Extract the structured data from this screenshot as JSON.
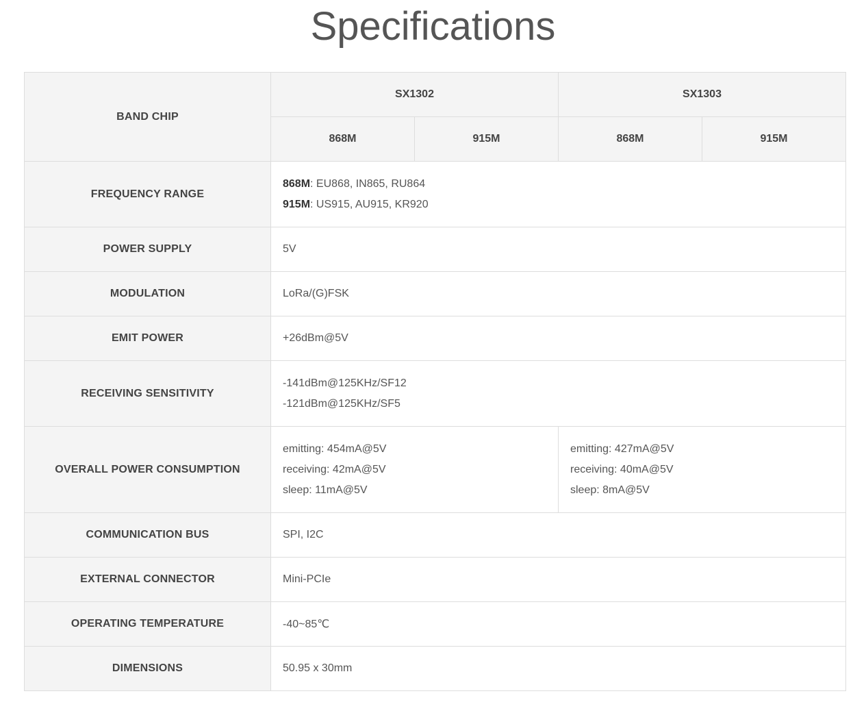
{
  "title": "Specifications",
  "table": {
    "band_chip_label": "BAND CHIP",
    "chips": [
      {
        "name": "SX1302",
        "bands": [
          "868M",
          "915M"
        ]
      },
      {
        "name": "SX1303",
        "bands": [
          "868M",
          "915M"
        ]
      }
    ],
    "frequency_range": {
      "label": "FREQUENCY RANGE",
      "lines": [
        {
          "key": "868M",
          "value": ": EU868, IN865, RU864"
        },
        {
          "key": "915M",
          "value": ": US915, AU915, KR920"
        }
      ]
    },
    "power_supply": {
      "label": "POWER SUPPLY",
      "value": "5V"
    },
    "modulation": {
      "label": "MODULATION",
      "value": "LoRa/(G)FSK"
    },
    "emit_power": {
      "label": "EMIT POWER",
      "value": "+26dBm@5V"
    },
    "receiving_sensitivity": {
      "label": "RECEIVING SENSITIVITY",
      "lines": [
        "-141dBm@125KHz/SF12",
        "-121dBm@125KHz/SF5"
      ]
    },
    "overall_power_consumption": {
      "label": "OVERALL POWER CONSUMPTION",
      "sx1302": [
        "emitting: 454mA@5V",
        "receiving: 42mA@5V",
        "sleep: 11mA@5V"
      ],
      "sx1303": [
        "emitting: 427mA@5V",
        "receiving: 40mA@5V",
        "sleep: 8mA@5V"
      ]
    },
    "communication_bus": {
      "label": "COMMUNICATION BUS",
      "value": "SPI, I2C"
    },
    "external_connector": {
      "label": "EXTERNAL CONNECTOR",
      "value": "Mini-PCIe"
    },
    "operating_temperature": {
      "label": "OPERATING TEMPERATURE",
      "value": "-40~85℃"
    },
    "dimensions": {
      "label": "DIMENSIONS",
      "value": "50.95 x 30mm"
    }
  }
}
